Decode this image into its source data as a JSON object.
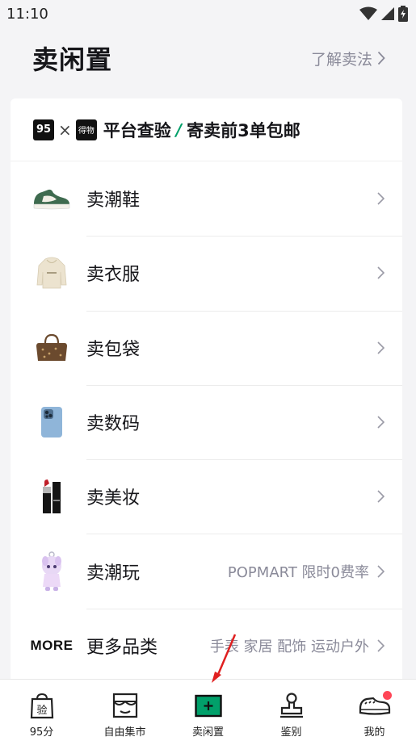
{
  "status_bar": {
    "time": "11:10"
  },
  "header": {
    "title": "卖闲置",
    "learn_link": "了解卖法"
  },
  "banner": {
    "logo_95": "95",
    "times": "×",
    "logo_de": "得物",
    "text_left": "平台查验",
    "slash": "/",
    "text_right": "寄卖前3单包邮"
  },
  "categories": [
    {
      "label": "卖潮鞋",
      "note": "",
      "icon": "sneaker-icon"
    },
    {
      "label": "卖衣服",
      "note": "",
      "icon": "hoodie-icon"
    },
    {
      "label": "卖包袋",
      "note": "",
      "icon": "handbag-icon"
    },
    {
      "label": "卖数码",
      "note": "",
      "icon": "phone-icon"
    },
    {
      "label": "卖美妆",
      "note": "",
      "icon": "lipstick-icon"
    },
    {
      "label": "卖潮玩",
      "note": "POPMART 限时0费率",
      "icon": "toy-figure-icon"
    },
    {
      "label": "更多品类",
      "note": "手表 家居 配饰 运动户外",
      "icon": "more-text-icon",
      "icon_text": "MORE"
    }
  ],
  "tabbar": {
    "tabs": [
      {
        "label": "95分",
        "icon": "shopping-bag-icon",
        "icon_text": "验"
      },
      {
        "label": "自由集市",
        "icon": "market-stall-icon"
      },
      {
        "label": "卖闲置",
        "icon": "sell-plus-icon"
      },
      {
        "label": "鉴别",
        "icon": "stamp-icon"
      },
      {
        "label": "我的",
        "icon": "profile-sneaker-icon"
      }
    ]
  },
  "colors": {
    "accent_green": "#01a06a",
    "badge_red": "#ff4657",
    "annotation_red": "#e02020"
  }
}
